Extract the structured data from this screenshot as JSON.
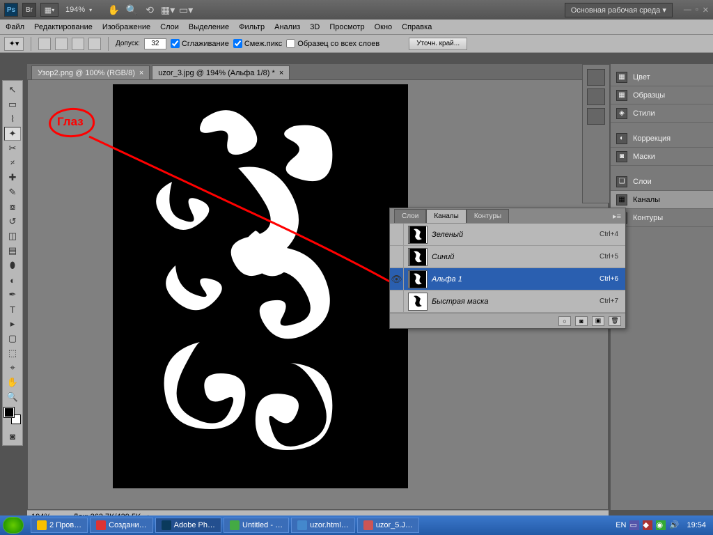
{
  "appbar": {
    "zoom": "194%",
    "workspace": "Основная рабочая среда ▾"
  },
  "menu": [
    "Файл",
    "Редактирование",
    "Изображение",
    "Слои",
    "Выделение",
    "Фильтр",
    "Анализ",
    "3D",
    "Просмотр",
    "Окно",
    "Справка"
  ],
  "options": {
    "tolerance_label": "Допуск:",
    "tolerance_value": "32",
    "antialias": "Сглаживание",
    "contiguous": "Смеж.пикс",
    "all_layers": "Образец со всех слоев",
    "refine": "Уточн. край..."
  },
  "doc_tabs": [
    {
      "label": "Узор2.png @ 100% (RGB/8)",
      "active": false
    },
    {
      "label": "uzor_3.jpg @ 194% (Альфа 1/8) *",
      "active": true
    }
  ],
  "annotation": {
    "label": "Глаз"
  },
  "right_panels": {
    "group1": [
      "Цвет",
      "Образцы",
      "Стили"
    ],
    "group2": [
      "Коррекция",
      "Маски"
    ],
    "group3": [
      "Слои",
      "Каналы",
      "Контуры"
    ],
    "active": "Каналы"
  },
  "channels_panel": {
    "tabs": [
      "Слои",
      "Каналы",
      "Контуры"
    ],
    "active_tab": "Каналы",
    "rows": [
      {
        "name": "Зеленый",
        "key": "Ctrl+4",
        "eye": false,
        "sel": false
      },
      {
        "name": "Синий",
        "key": "Ctrl+5",
        "eye": false,
        "sel": false
      },
      {
        "name": "Альфа 1",
        "key": "Ctrl+6",
        "eye": true,
        "sel": true
      },
      {
        "name": "Быстрая маска",
        "key": "Ctrl+7",
        "eye": false,
        "sel": false
      }
    ]
  },
  "status": {
    "zoom": "194%",
    "doc": "Док: 263,7K/439,5K"
  },
  "taskbar": {
    "items": [
      {
        "label": "2 Пров…",
        "ico": "#f7c000"
      },
      {
        "label": "Создани…",
        "ico": "#d33"
      },
      {
        "label": "Adobe Ph…",
        "ico": "#0a3a5c",
        "active": true
      },
      {
        "label": "Untitled - …",
        "ico": "#4a4"
      },
      {
        "label": "uzor.html…",
        "ico": "#48c"
      },
      {
        "label": "uzor_5.J…",
        "ico": "#c55"
      }
    ],
    "lang": "EN",
    "clock": "19:54"
  }
}
